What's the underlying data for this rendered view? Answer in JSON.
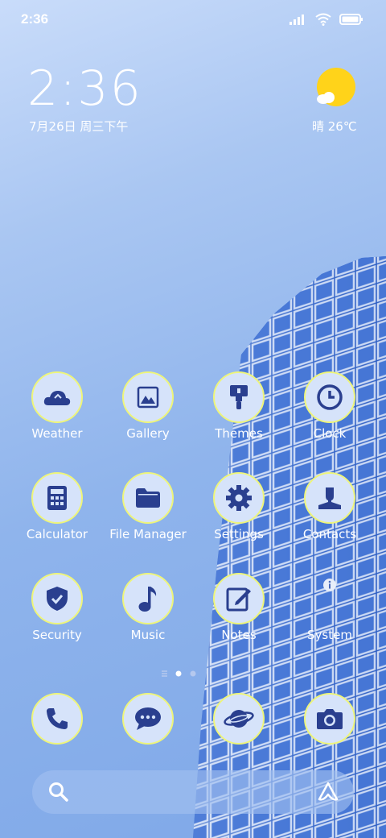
{
  "status_bar": {
    "time": "2:36"
  },
  "widget": {
    "clock": "2:36",
    "date": "7月26日 周三下午",
    "weather": "晴 26℃"
  },
  "apps": [
    {
      "label": "Weather",
      "icon": "weather-icon"
    },
    {
      "label": "Gallery",
      "icon": "gallery-icon"
    },
    {
      "label": "Themes",
      "icon": "paintbrush-icon"
    },
    {
      "label": "Clock",
      "icon": "clock-icon"
    },
    {
      "label": "Calculator",
      "icon": "calculator-icon"
    },
    {
      "label": "File Manager",
      "icon": "folder-icon"
    },
    {
      "label": "Settings",
      "icon": "gear-icon"
    },
    {
      "label": "Contacts",
      "icon": "person-icon"
    },
    {
      "label": "Security",
      "icon": "shield-icon"
    },
    {
      "label": "Music",
      "icon": "music-note-icon"
    },
    {
      "label": "Notes",
      "icon": "notes-icon"
    },
    {
      "label": "System",
      "icon": "info-icon"
    }
  ],
  "dock": [
    {
      "icon": "phone-icon"
    },
    {
      "icon": "message-icon"
    },
    {
      "icon": "browser-icon"
    },
    {
      "icon": "camera-icon"
    }
  ],
  "colors": {
    "icon_fg": "#2a3f8f",
    "icon_bg": "#d6e3fa",
    "icon_ring": "#eef57a",
    "sun": "#ffd31a"
  }
}
